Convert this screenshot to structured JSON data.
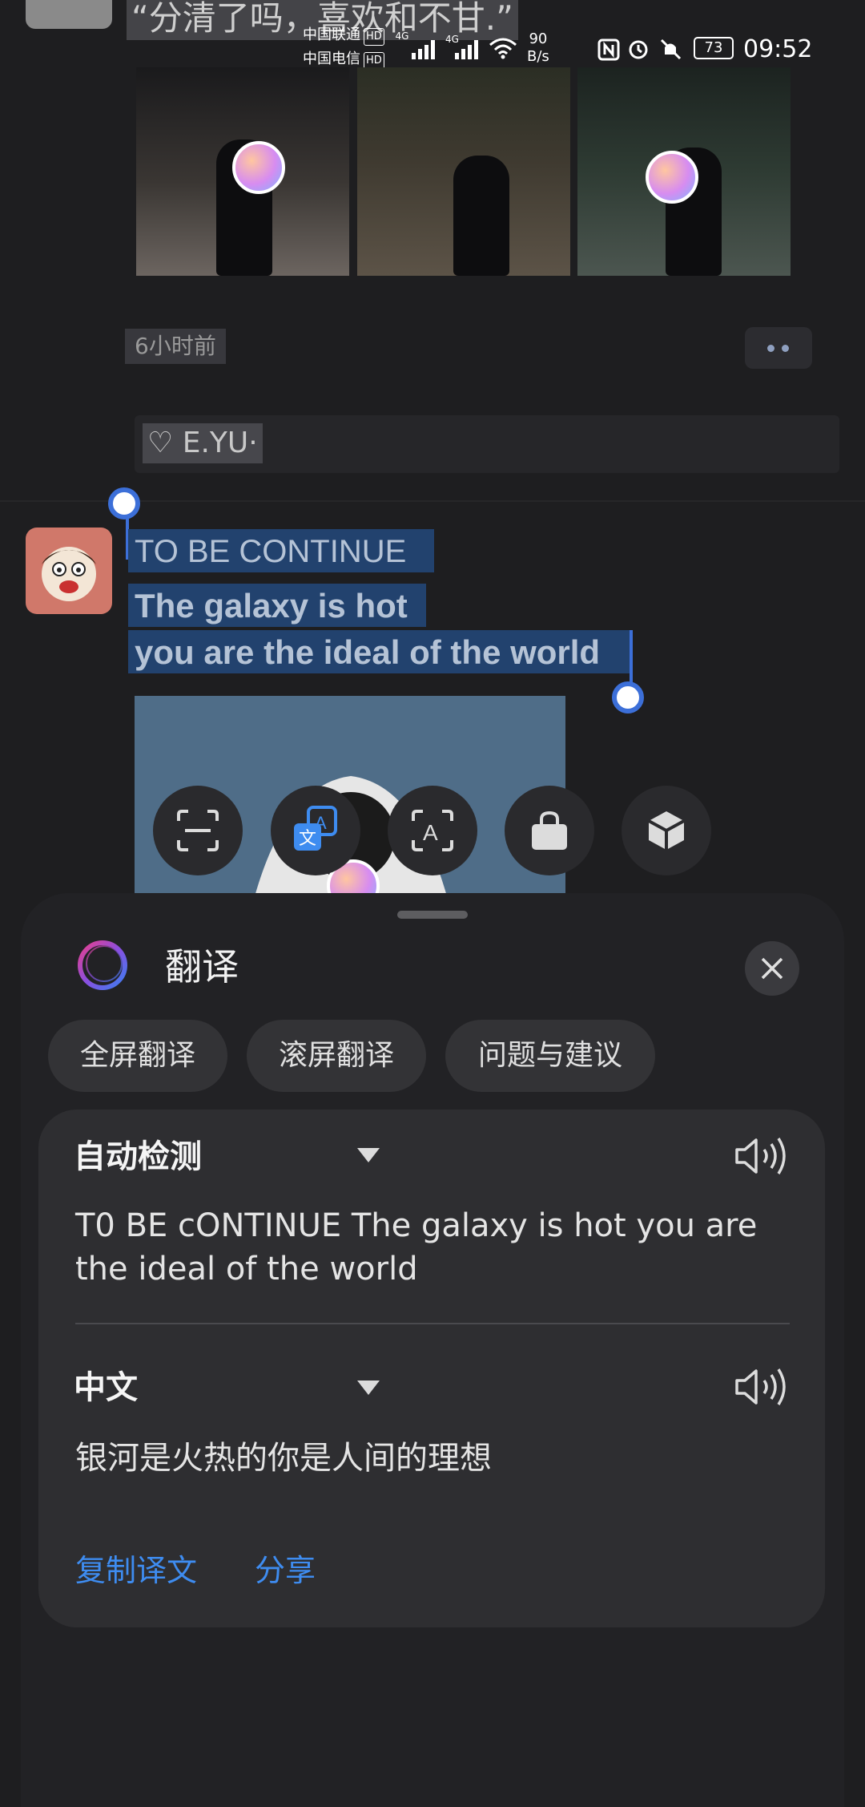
{
  "status_bar": {
    "carrier1": "中国联通",
    "carrier2": "中国电信",
    "hd_badge": "HD",
    "network1": "4G",
    "network2": "4G",
    "speed_value": "90",
    "speed_unit": "B/s",
    "battery": "73",
    "time": "09:52"
  },
  "feed": {
    "quote": "“分清了吗，喜欢和不甘.”",
    "timestamp": "6小时前",
    "like_text": "♡ E.YU·",
    "selected_text": {
      "line1": "TO  BE  CONTINUE",
      "line2": "The galaxy is hot",
      "line3": "you are the ideal of the world"
    }
  },
  "toolbar": {
    "items": [
      "scan-icon",
      "translate-icon",
      "text-recognition-icon",
      "shopping-icon",
      "3d-object-icon"
    ]
  },
  "sheet": {
    "title": "翻译",
    "chips": [
      "全屏翻译",
      "滚屏翻译",
      "问题与建议"
    ],
    "source": {
      "language": "自动检测",
      "text": "T0 BE cONTINUE The galaxy is hot you are the ideal of the world"
    },
    "target": {
      "language": "中文",
      "text": "银河是火热的你是人间的理想"
    },
    "actions": {
      "copy": "复制译文",
      "share": "分享"
    }
  },
  "colors": {
    "accent": "#3e8cf0",
    "selection": "#22426e",
    "sheet_bg": "#222225",
    "card_bg": "#2e2e31"
  }
}
